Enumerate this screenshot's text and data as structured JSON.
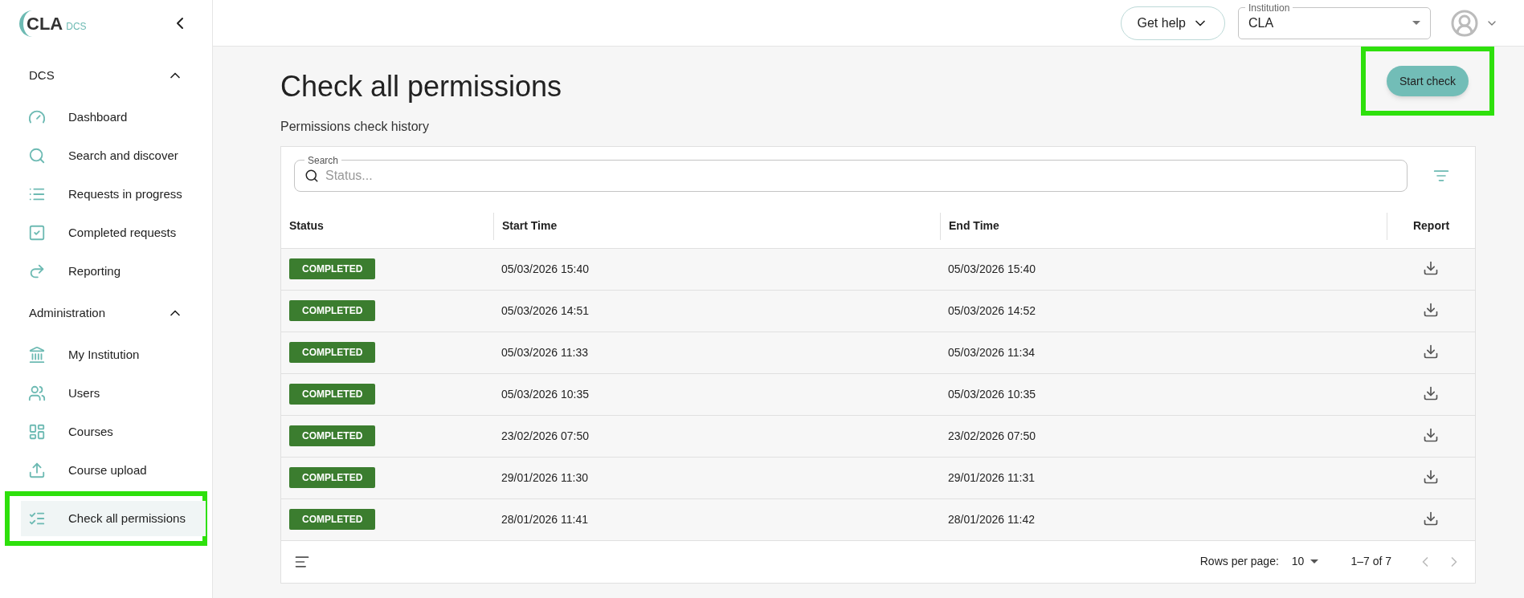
{
  "logo": {
    "mark": "CLA",
    "product": "DCS"
  },
  "sidebar": {
    "sections": [
      {
        "title": "DCS",
        "expanded": true,
        "items": [
          {
            "label": "Dashboard",
            "selected": false
          },
          {
            "label": "Search and discover",
            "selected": false
          },
          {
            "label": "Requests in progress",
            "selected": false
          },
          {
            "label": "Completed requests",
            "selected": false
          },
          {
            "label": "Reporting",
            "selected": false
          }
        ]
      },
      {
        "title": "Administration",
        "expanded": true,
        "items": [
          {
            "label": "My Institution",
            "selected": false
          },
          {
            "label": "Users",
            "selected": false
          },
          {
            "label": "Courses",
            "selected": false
          },
          {
            "label": "Course upload",
            "selected": false
          },
          {
            "label": "Check all permissions",
            "selected": true,
            "highlighted": true
          }
        ]
      }
    ]
  },
  "topbar": {
    "help_button": "Get help",
    "institution": {
      "label": "Institution",
      "value": "CLA"
    }
  },
  "page": {
    "title": "Check all permissions",
    "start_button": {
      "label": "Start check",
      "highlighted": true
    },
    "subtitle": "Permissions check history"
  },
  "table": {
    "search": {
      "label": "Search",
      "placeholder": "Status..."
    },
    "columns": [
      "Status",
      "Start Time",
      "End Time",
      "Report"
    ],
    "rows": [
      {
        "status": "COMPLETED",
        "start": "05/03/2026 15:40",
        "end": "05/03/2026 15:40"
      },
      {
        "status": "COMPLETED",
        "start": "05/03/2026 14:51",
        "end": "05/03/2026 14:52"
      },
      {
        "status": "COMPLETED",
        "start": "05/03/2026 11:33",
        "end": "05/03/2026 11:34"
      },
      {
        "status": "COMPLETED",
        "start": "05/03/2026 10:35",
        "end": "05/03/2026 10:35"
      },
      {
        "status": "COMPLETED",
        "start": "23/02/2026 07:50",
        "end": "23/02/2026 07:50"
      },
      {
        "status": "COMPLETED",
        "start": "29/01/2026 11:30",
        "end": "29/01/2026 11:31"
      },
      {
        "status": "COMPLETED",
        "start": "28/01/2026 11:41",
        "end": "28/01/2026 11:42"
      }
    ],
    "pagination": {
      "rows_per_page_label": "Rows per page:",
      "rows_per_page": "10",
      "range": "1–7 of 7"
    }
  }
}
